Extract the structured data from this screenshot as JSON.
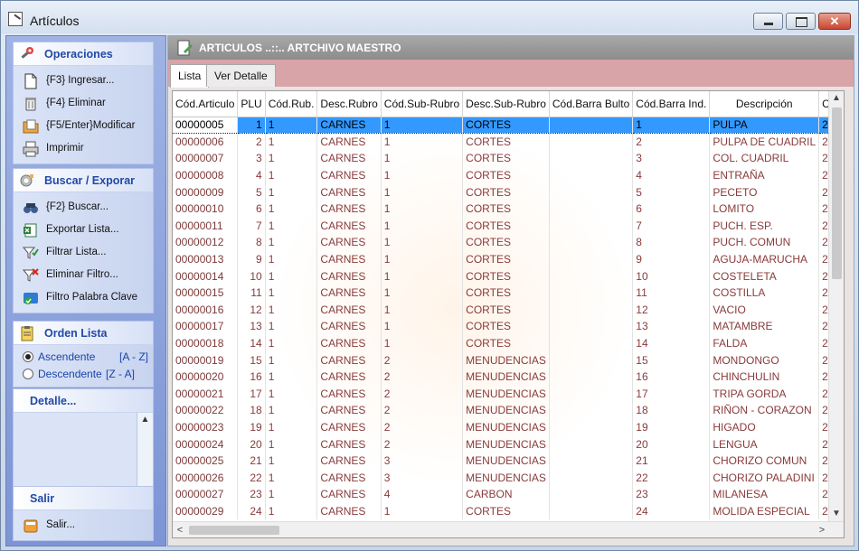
{
  "window": {
    "title": "Artículos",
    "close_glyph": "✕"
  },
  "sidebar": {
    "operaciones": {
      "title": "Operaciones",
      "items": [
        {
          "label": "{F3} Ingresar...",
          "icon": "new-document-icon"
        },
        {
          "label": "{F4} Eliminar",
          "icon": "trash-icon"
        },
        {
          "label": "{F5/Enter}Modificar",
          "icon": "folder-edit-icon"
        },
        {
          "label": "Imprimir",
          "icon": "printer-icon"
        }
      ]
    },
    "buscar": {
      "title": "Buscar / Exporar",
      "items": [
        {
          "label": "{F2} Buscar...",
          "icon": "binoculars-icon"
        },
        {
          "label": "Exportar Lista...",
          "icon": "excel-icon"
        },
        {
          "label": "Filtrar Lista...",
          "icon": "filter-icon"
        },
        {
          "label": "Eliminar Filtro...",
          "icon": "filter-remove-icon"
        },
        {
          "label": "Filtro Palabra Clave",
          "icon": "keyword-filter-icon"
        }
      ]
    },
    "orden": {
      "title": "Orden Lista",
      "options": [
        {
          "label": "Ascendente",
          "key": "[A - Z]",
          "selected": true
        },
        {
          "label": "Descendente",
          "key": "[Z - A]",
          "selected": false
        }
      ]
    },
    "detalle": {
      "title": "Detalle..."
    },
    "salir": {
      "title": "Salir",
      "item": "Salir..."
    }
  },
  "main": {
    "header_title": "ARTICULOS ..::.. ARTCHIVO MAESTRO",
    "tabs": [
      {
        "label": "Lista",
        "active": true
      },
      {
        "label": "Ver Detalle",
        "active": false
      }
    ]
  },
  "grid": {
    "columns": [
      "Cód.Articulo",
      "PLU",
      "Cód.Rub.",
      "Desc.Rubro",
      "Cód.Sub-Rubro",
      "Desc.Sub-Rubro",
      "Cód.Barra Bulto",
      "Cód.Barra Ind.",
      "Descripción",
      "Cód.Mar"
    ],
    "rows": [
      [
        "00000005",
        "1",
        "1",
        "CARNES",
        "1",
        "CORTES",
        "",
        "1",
        "PULPA",
        "2"
      ],
      [
        "00000006",
        "2",
        "1",
        "CARNES",
        "1",
        "CORTES",
        "",
        "2",
        "PULPA DE CUADRIL",
        "2"
      ],
      [
        "00000007",
        "3",
        "1",
        "CARNES",
        "1",
        "CORTES",
        "",
        "3",
        "COL. CUADRIL",
        "2"
      ],
      [
        "00000008",
        "4",
        "1",
        "CARNES",
        "1",
        "CORTES",
        "",
        "4",
        "ENTRAÑA",
        "2"
      ],
      [
        "00000009",
        "5",
        "1",
        "CARNES",
        "1",
        "CORTES",
        "",
        "5",
        "PECETO",
        "2"
      ],
      [
        "00000010",
        "6",
        "1",
        "CARNES",
        "1",
        "CORTES",
        "",
        "6",
        "LOMITO",
        "2"
      ],
      [
        "00000011",
        "7",
        "1",
        "CARNES",
        "1",
        "CORTES",
        "",
        "7",
        "PUCH. ESP.",
        "2"
      ],
      [
        "00000012",
        "8",
        "1",
        "CARNES",
        "1",
        "CORTES",
        "",
        "8",
        "PUCH. COMUN",
        "2"
      ],
      [
        "00000013",
        "9",
        "1",
        "CARNES",
        "1",
        "CORTES",
        "",
        "9",
        "AGUJA-MARUCHA",
        "2"
      ],
      [
        "00000014",
        "10",
        "1",
        "CARNES",
        "1",
        "CORTES",
        "",
        "10",
        "COSTELETA",
        "2"
      ],
      [
        "00000015",
        "11",
        "1",
        "CARNES",
        "1",
        "CORTES",
        "",
        "11",
        "COSTILLA",
        "2"
      ],
      [
        "00000016",
        "12",
        "1",
        "CARNES",
        "1",
        "CORTES",
        "",
        "12",
        "VACIO",
        "2"
      ],
      [
        "00000017",
        "13",
        "1",
        "CARNES",
        "1",
        "CORTES",
        "",
        "13",
        "MATAMBRE",
        "2"
      ],
      [
        "00000018",
        "14",
        "1",
        "CARNES",
        "1",
        "CORTES",
        "",
        "14",
        "FALDA",
        "2"
      ],
      [
        "00000019",
        "15",
        "1",
        "CARNES",
        "2",
        "MENUDENCIAS",
        "",
        "15",
        "MONDONGO",
        "2"
      ],
      [
        "00000020",
        "16",
        "1",
        "CARNES",
        "2",
        "MENUDENCIAS",
        "",
        "16",
        "CHINCHULIN",
        "2"
      ],
      [
        "00000021",
        "17",
        "1",
        "CARNES",
        "2",
        "MENUDENCIAS",
        "",
        "17",
        "TRIPA GORDA",
        "2"
      ],
      [
        "00000022",
        "18",
        "1",
        "CARNES",
        "2",
        "MENUDENCIAS",
        "",
        "18",
        "RIÑON - CORAZON",
        "2"
      ],
      [
        "00000023",
        "19",
        "1",
        "CARNES",
        "2",
        "MENUDENCIAS",
        "",
        "19",
        "HIGADO",
        "2"
      ],
      [
        "00000024",
        "20",
        "1",
        "CARNES",
        "2",
        "MENUDENCIAS",
        "",
        "20",
        "LENGUA",
        "2"
      ],
      [
        "00000025",
        "21",
        "1",
        "CARNES",
        "3",
        "MENUDENCIAS",
        "",
        "21",
        "CHORIZO COMUN",
        "2"
      ],
      [
        "00000026",
        "22",
        "1",
        "CARNES",
        "3",
        "MENUDENCIAS",
        "",
        "22",
        "CHORIZO PALADINI",
        "2"
      ],
      [
        "00000027",
        "23",
        "1",
        "CARNES",
        "4",
        "CARBON",
        "",
        "23",
        "MILANESA",
        "2"
      ],
      [
        "00000029",
        "24",
        "1",
        "CARNES",
        "1",
        "CORTES",
        "",
        "24",
        "MOLIDA ESPECIAL",
        "2"
      ]
    ],
    "selected_row": 0,
    "scroll_arrows": {
      "up": "▲",
      "down": "▼",
      "left": "<",
      "right": ">"
    }
  }
}
